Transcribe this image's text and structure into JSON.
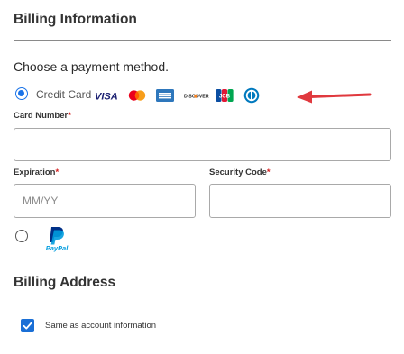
{
  "billing": {
    "title": "Billing Information",
    "prompt": "Choose a payment method."
  },
  "payment_methods": {
    "credit_card": {
      "label": "Credit Card",
      "selected": true,
      "card_brands": [
        "visa",
        "mastercard",
        "amex",
        "discover",
        "jcb",
        "diners-club"
      ],
      "visa_text": "VISA",
      "discover_text": "DISCOVER",
      "jcb_text": "JCB"
    },
    "paypal": {
      "selected": false,
      "logo_text": "PayPal"
    }
  },
  "fields": {
    "card_number": {
      "label": "Card Number",
      "required_mark": "*",
      "value": ""
    },
    "expiration": {
      "label": "Expiration",
      "required_mark": "*",
      "placeholder": "MM/YY",
      "value": ""
    },
    "security_code": {
      "label": "Security Code",
      "required_mark": "*",
      "value": ""
    }
  },
  "address": {
    "title": "Billing Address",
    "same_as_account": {
      "label": "Same as account information",
      "checked": true
    }
  },
  "colors": {
    "accent": "#1a73e8",
    "required": "#d42020",
    "annotation_arrow": "#e0393e"
  }
}
